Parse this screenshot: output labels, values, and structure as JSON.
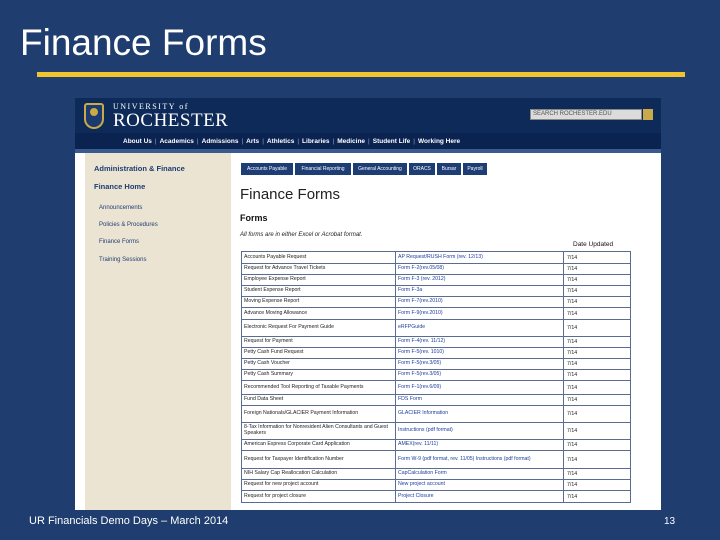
{
  "slide": {
    "title": "Finance Forms",
    "footer_left": "UR Financials Demo Days – March 2014",
    "page_number": "13",
    "accent_color": "#f2c230",
    "background_color": "#1f3d6e"
  },
  "screenshot": {
    "header": {
      "university_line1": "UNIVERSITY of",
      "university_line2": "ROCHESTER",
      "search_placeholder": "SEARCH ROCHESTER.EDU",
      "nav": [
        "About Us",
        "Academics",
        "Admissions",
        "Arts",
        "Athletics",
        "Libraries",
        "Medicine",
        "Student Life",
        "Working Here"
      ],
      "nav_separator": "|"
    },
    "sidebar": {
      "heading": "Administration & Finance",
      "subheading": "Finance Home",
      "items": [
        "Announcements",
        "Policies & Procedures",
        "Finance Forms",
        "Training Sessions"
      ]
    },
    "tabs": [
      "Accounts Payable",
      "Financial Reporting",
      "General Accounting",
      "ORACS",
      "Bursar",
      "Payroll"
    ],
    "page_title": "Finance Forms",
    "section_heading": "Forms",
    "note": "All forms are in either Excel or Acrobat format.",
    "date_header": "Date Updated",
    "rows": [
      {
        "name": "Accounts Payable Request",
        "form": "AP Request/RUSH Form (rev. 12/13)",
        "date": "7/14"
      },
      {
        "name": "Request for Advance Travel Tickets",
        "form": "Form F-2(rev.05/08)",
        "date": "7/14"
      },
      {
        "name": "Employee Expense Report",
        "form": "Form F-3 (rev. 2012)",
        "date": "7/14"
      },
      {
        "name": "Student Expense Report",
        "form": "Form F-3a",
        "date": "7/14"
      },
      {
        "name": "Moving Expense Report",
        "form": "Form F-7(rev.2010)",
        "date": "7/14"
      },
      {
        "name": "Advance Moving Allowance",
        "form": "Form F-9(rev.2010)",
        "date": "7/14"
      },
      {
        "name": "Electronic Request For Payment Guide",
        "form": "eRFPGuide",
        "date": "7/14"
      },
      {
        "name": "Request for Payment",
        "form": "Form F-4(rev. 11/12)",
        "date": "7/14"
      },
      {
        "name": "Petty Cash Fund Request",
        "form": "Form F-5(rev. 1010)",
        "date": "7/14"
      },
      {
        "name": "Petty Cash Voucher",
        "form": "Form F-5(rev.3/05)",
        "date": "7/14"
      },
      {
        "name": "Petty Cash Summary",
        "form": "Form F-5(rev.3/05)",
        "date": "7/14"
      },
      {
        "name": "Recommended Tool Reporting of Taxable Payments",
        "form": "Form F-1(rev.6/09)",
        "date": "7/14"
      },
      {
        "name": "Fund Data Sheet",
        "form": "FDS Form",
        "date": "7/14"
      },
      {
        "name": "Foreign Nationals/GLACIER Payment Information",
        "form": "GLACIER Information",
        "date": "7/14"
      },
      {
        "name": "8-Tax Information for Nonresident Alien Consultants and Guest Speakers",
        "form": "Instructions (pdf format)",
        "date": "7/14"
      },
      {
        "name": "American Express Corporate Card Application",
        "form": "AMEX(rev. 11/11)",
        "date": "7/14"
      },
      {
        "name": "Request for Taxpayer Identification Number",
        "form": "Form W-9 (pdf format, rev. 11/05) Instructions (pdf format)",
        "date": "7/14"
      },
      {
        "name": "NIH Salary Cap Reallocation Calculation",
        "form": "CapCalculation Form",
        "date": "7/14"
      },
      {
        "name": "Request for new project account",
        "form": "New project account",
        "date": "7/14"
      },
      {
        "name": "Request for project closure",
        "form": "Project Closure",
        "date": "7/14"
      }
    ]
  }
}
